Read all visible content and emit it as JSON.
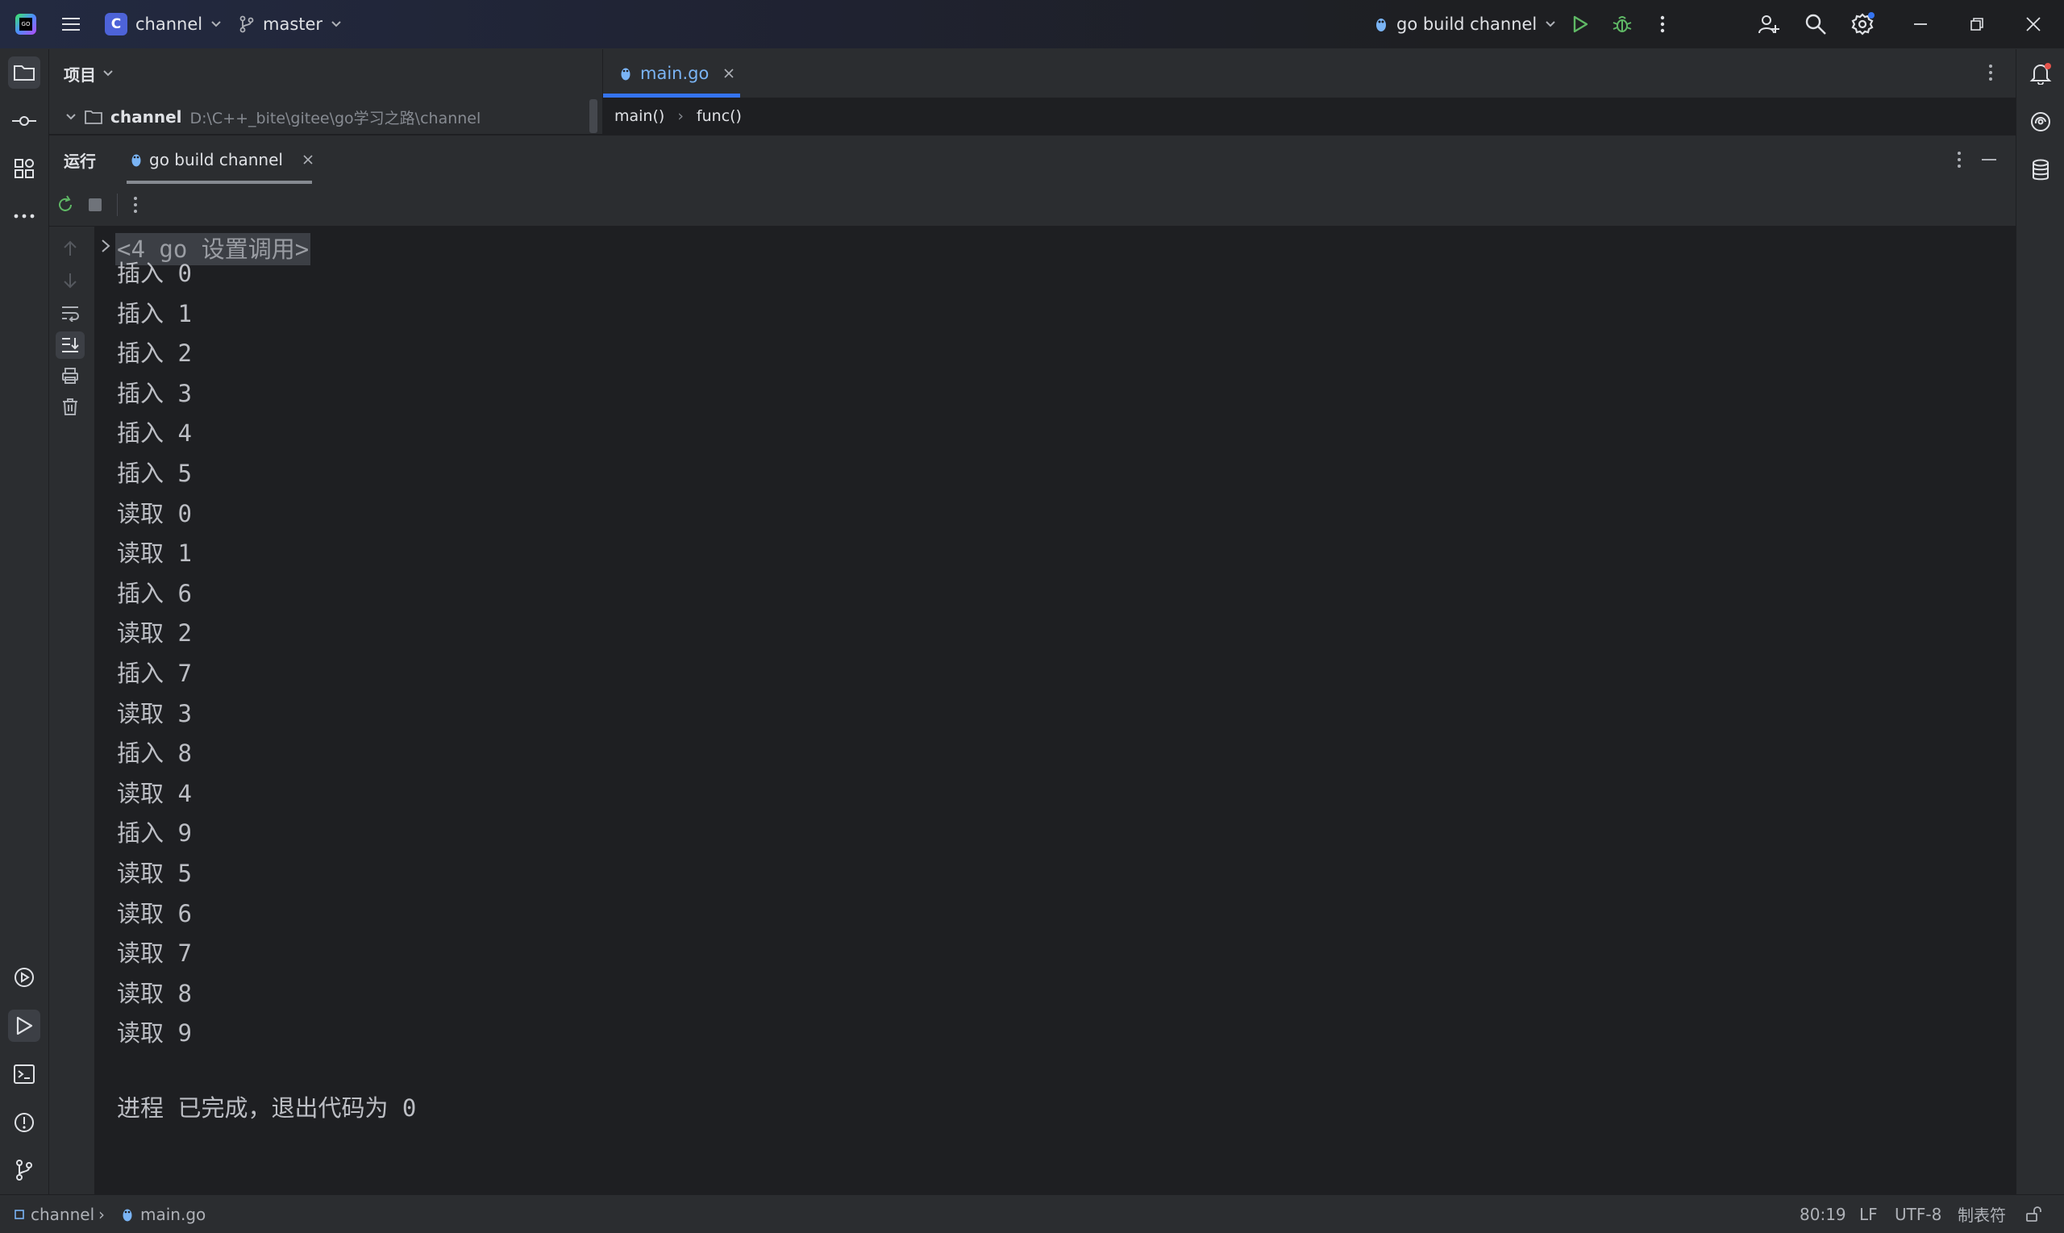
{
  "titlebar": {
    "project_badge": "C",
    "project_name": "channel",
    "branch": "master",
    "run_config": "go build channel"
  },
  "project_panel": {
    "title": "项目",
    "root_name": "channel",
    "root_path": "D:\\C++_bite\\gitee\\go学习之路\\channel"
  },
  "editor": {
    "tab_label": "main.go",
    "breadcrumb": [
      "main()",
      "func()"
    ]
  },
  "run_panel": {
    "title": "运行",
    "tab_label": "go build channel"
  },
  "console": {
    "header": "<4 go 设置调用>",
    "lines": [
      "插入 0",
      "插入 1",
      "插入 2",
      "插入 3",
      "插入 4",
      "插入 5",
      "读取 0",
      "读取 1",
      "插入 6",
      "读取 2",
      "插入 7",
      "读取 3",
      "插入 8",
      "读取 4",
      "插入 9",
      "读取 5",
      "读取 6",
      "读取 7",
      "读取 8",
      "读取 9"
    ],
    "footer": "进程 已完成，退出代码为 0"
  },
  "statusbar": {
    "project": "channel",
    "file": "main.go",
    "position": "80:19",
    "line_sep": "LF",
    "encoding": "UTF-8",
    "indent": "制表符"
  },
  "colors": {
    "accent": "#3574f0",
    "run_green": "#5fb865",
    "background": "#1e1f22",
    "panel": "#2b2d30"
  },
  "icons": [
    "app-logo-icon",
    "main-menu-icon",
    "branch-icon",
    "go-file-icon",
    "run-icon",
    "debug-icon",
    "more-icon",
    "add-user-icon",
    "search-icon",
    "settings-icon",
    "minimize-icon",
    "restore-icon",
    "close-icon",
    "folder-icon",
    "commit-icon",
    "structure-icon",
    "services-icon",
    "run-tool-icon",
    "terminal-icon",
    "problems-icon",
    "git-icon",
    "notifications-icon",
    "ai-assistant-icon",
    "database-icon",
    "rerun-icon",
    "stop-icon",
    "up-arrow-icon",
    "down-arrow-icon",
    "soft-wrap-icon",
    "scroll-end-icon",
    "print-icon",
    "trash-icon",
    "lock-icon"
  ]
}
